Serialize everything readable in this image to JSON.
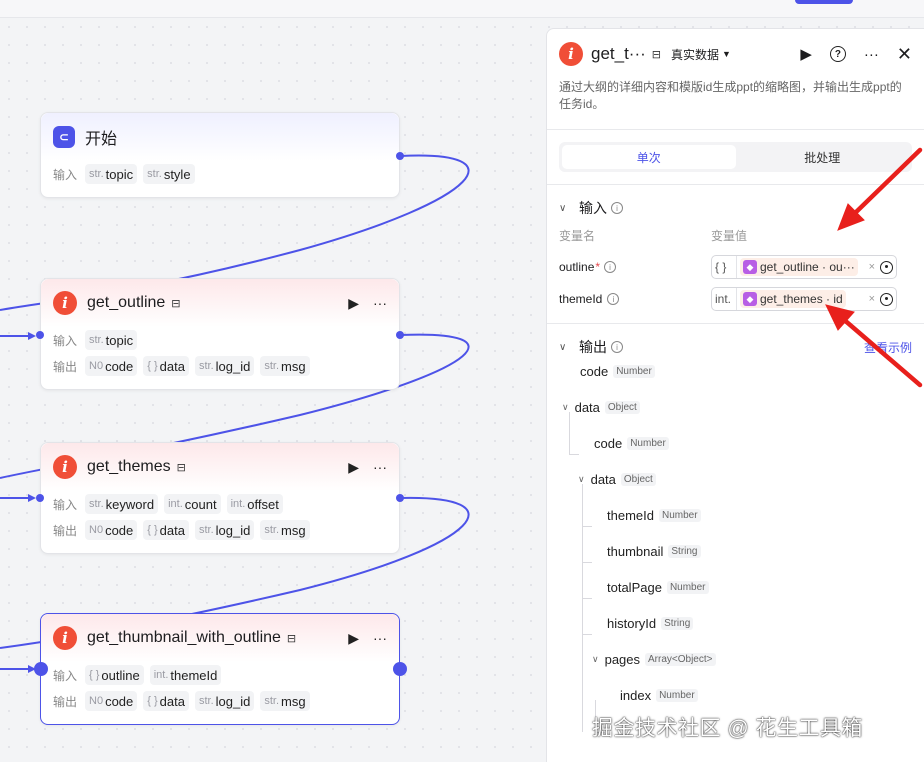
{
  "canvas": {
    "nodes": [
      {
        "id": "start",
        "title": "开始",
        "icon": "start-icon",
        "inputs_label": "输入",
        "inputs": [
          {
            "type": "str.",
            "name": "topic"
          },
          {
            "type": "str.",
            "name": "style"
          }
        ]
      },
      {
        "id": "get_outline",
        "title": "get_outline",
        "icon": "plugin-icon",
        "inputs_label": "输入",
        "inputs": [
          {
            "type": "str.",
            "name": "topic"
          }
        ],
        "outputs_label": "输出",
        "outputs": [
          {
            "type": "N0",
            "name": "code"
          },
          {
            "type": "{ }",
            "name": "data"
          },
          {
            "type": "str.",
            "name": "log_id"
          },
          {
            "type": "str.",
            "name": "msg"
          }
        ]
      },
      {
        "id": "get_themes",
        "title": "get_themes",
        "icon": "plugin-icon",
        "inputs_label": "输入",
        "inputs": [
          {
            "type": "str.",
            "name": "keyword"
          },
          {
            "type": "int.",
            "name": "count"
          },
          {
            "type": "int.",
            "name": "offset"
          }
        ],
        "outputs_label": "输出",
        "outputs": [
          {
            "type": "N0",
            "name": "code"
          },
          {
            "type": "{ }",
            "name": "data"
          },
          {
            "type": "str.",
            "name": "log_id"
          },
          {
            "type": "str.",
            "name": "msg"
          }
        ]
      },
      {
        "id": "get_thumbnail_with_outline",
        "title": "get_thumbnail_with_outline",
        "icon": "plugin-icon",
        "inputs_label": "输入",
        "inputs": [
          {
            "type": "{ }",
            "name": "outline"
          },
          {
            "type": "int.",
            "name": "themeId"
          }
        ],
        "outputs_label": "输出",
        "outputs": [
          {
            "type": "N0",
            "name": "code"
          },
          {
            "type": "{ }",
            "name": "data"
          },
          {
            "type": "str.",
            "name": "log_id"
          },
          {
            "type": "str.",
            "name": "msg"
          }
        ]
      }
    ],
    "edge_color": "#4d53e8"
  },
  "panel": {
    "title": "get_t···",
    "mode": "真实数据",
    "description": "通过大纲的详细内容和模版id生成ppt的缩略图，并输出生成ppt的任务id。",
    "tabs": [
      "单次",
      "批处理"
    ],
    "input_section": "输入",
    "col_name": "变量名",
    "col_value": "变量值",
    "input_rows": [
      {
        "name": "outline",
        "required": "*",
        "type": "{ }",
        "ref": "get_outline · ou···"
      },
      {
        "name": "themeId",
        "required": "",
        "type": "int.",
        "ref": "get_themes · id"
      }
    ],
    "output_section": "输出",
    "output_link": "查看示例",
    "tree": [
      {
        "name": "code",
        "type": "Number",
        "level": 0
      },
      {
        "name": "data",
        "type": "Object",
        "level": 0,
        "expandable": true
      },
      {
        "name": "code",
        "type": "Number",
        "level": 1
      },
      {
        "name": "data",
        "type": "Object",
        "level": 1,
        "expandable": true
      },
      {
        "name": "themeId",
        "type": "Number",
        "level": 2
      },
      {
        "name": "thumbnail",
        "type": "String",
        "level": 2
      },
      {
        "name": "totalPage",
        "type": "Number",
        "level": 2
      },
      {
        "name": "historyId",
        "type": "String",
        "level": 2
      },
      {
        "name": "pages",
        "type": "Array<Object>",
        "level": 2,
        "expandable": true
      },
      {
        "name": "index",
        "type": "Number",
        "level": 3
      }
    ]
  },
  "watermark": "掘金技术社区 @ 花生工具箱",
  "colors": {
    "accent": "#4d53e8",
    "plugin": "#f04e37",
    "annotation_arrow": "#e8201c",
    "ref_chip": "#fdeee7"
  }
}
